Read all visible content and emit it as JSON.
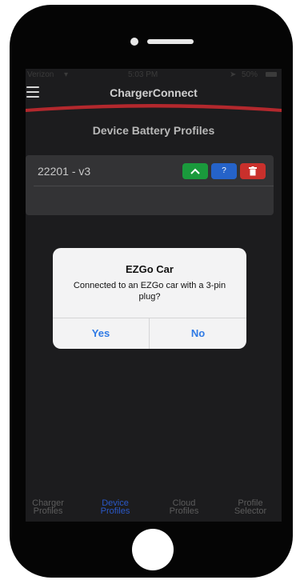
{
  "status": {
    "carrier": "Verizon",
    "time": "5:03 PM",
    "battery": "50%"
  },
  "app": {
    "title": "ChargerConnect",
    "accent_color": "#b3282d"
  },
  "page": {
    "title": "Device Battery Profiles"
  },
  "profile": {
    "name": "22201 - v3",
    "buttons": [
      {
        "icon": "chevron-up-icon",
        "color": "#1a9a3c"
      },
      {
        "label": "?",
        "icon": "help-icon",
        "color": "#2563c9"
      },
      {
        "icon": "trash-icon",
        "color": "#c9302c"
      }
    ]
  },
  "dialog": {
    "title": "EZGo Car",
    "message": "Connected to an EZGo car with a 3-pin plug?",
    "yes_label": "Yes",
    "no_label": "No"
  },
  "tabs": [
    {
      "line1": "Charger",
      "line2": "Profiles",
      "active": false
    },
    {
      "line1": "Device",
      "line2": "Profiles",
      "active": true
    },
    {
      "line1": "Cloud",
      "line2": "Profiles",
      "active": false
    },
    {
      "line1": "Profile",
      "line2": "Selector",
      "active": false
    }
  ]
}
